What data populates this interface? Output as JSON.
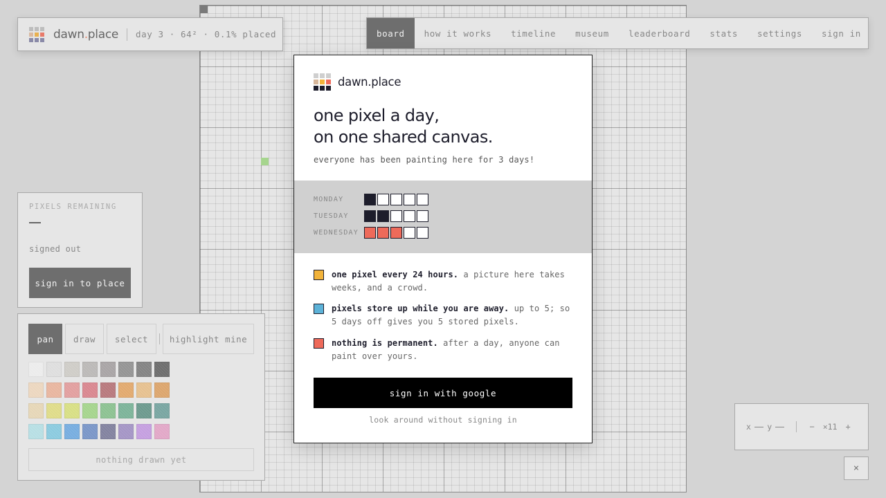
{
  "brand": {
    "name_main": "dawn",
    "name_dot": ".",
    "name_tld": "place",
    "stats": "day 3 · 64² · 0.1% placed",
    "logo_colors": [
      "#bdbdbd",
      "#bdbdbd",
      "#bdbdbd",
      "#d9b9a0",
      "#e8b050",
      "#e87a6a",
      "#8a8aa8",
      "#8a8aa8",
      "#8a8aa8"
    ]
  },
  "nav": {
    "items": [
      {
        "label": "board",
        "active": true
      },
      {
        "label": "how it works"
      },
      {
        "label": "timeline"
      },
      {
        "label": "museum"
      },
      {
        "label": "leaderboard"
      },
      {
        "label": "stats"
      },
      {
        "label": "settings"
      }
    ],
    "sign_in": "sign in"
  },
  "remaining": {
    "label": "PIXELS REMAINING",
    "status": "signed out",
    "signin_button": "sign in to place"
  },
  "tools": {
    "pan": "pan",
    "draw": "draw",
    "select": "select",
    "highlight": "highlight mine",
    "active": "pan",
    "palette": [
      [
        "#ececec",
        "#dedede",
        "#cfcdc8",
        "#bcbab8",
        "#a9a5a6",
        "#959595",
        "#848484",
        "#6e6e6e"
      ],
      [
        "#ecd7c0",
        "#e8b6a0",
        "#e2a0a0",
        "#d98890",
        "#b87a7e",
        "#e2aa70",
        "#e6c190",
        "#dca66e"
      ],
      [
        "#e6d7b8",
        "#dfdc8a",
        "#d8df86",
        "#a6d58e",
        "#8dc292",
        "#7db49a",
        "#6d9a8e",
        "#7aa6a2"
      ],
      [
        "#b8dfe4",
        "#8ccbdf",
        "#78aee0",
        "#7b97c8",
        "#8383a0",
        "#a596c6",
        "#c5a0e0",
        "#e2a8c8"
      ]
    ],
    "drawn_status": "nothing drawn yet"
  },
  "coords": {
    "x_label": "x",
    "y_label": "y",
    "zoom_out": "−",
    "zoom_level": "×11",
    "zoom_in": "+"
  },
  "close_label": "×",
  "canvas": {
    "placed_pixels": [
      {
        "col": 8,
        "row": 20,
        "color": "#a6d58e"
      }
    ]
  },
  "modal": {
    "brand": "dawn.place",
    "logo_colors": [
      "#cfcfcf",
      "#cfcfcf",
      "#cfcfcf",
      "#d6b69a",
      "#f2b33a",
      "#ee6a5a",
      "#1d1d2b",
      "#1d1d2b",
      "#1d1d2b"
    ],
    "headline_1": "one pixel a day,",
    "headline_2": "on one shared canvas.",
    "subline": "everyone has been painting here for 3 days!",
    "days": [
      {
        "label": "MONDAY",
        "cells": [
          "#1d1d2b",
          "#ffffff",
          "#ffffff",
          "#ffffff",
          "#ffffff"
        ]
      },
      {
        "label": "TUESDAY",
        "cells": [
          "#1d1d2b",
          "#1d1d2b",
          "#ffffff",
          "#ffffff",
          "#ffffff"
        ]
      },
      {
        "label": "WEDNESDAY",
        "cells": [
          "#ee6a5a",
          "#ee6a5a",
          "#ee6a5a",
          "#ffffff",
          "#ffffff"
        ]
      }
    ],
    "rules": [
      {
        "color": "#f2b33a",
        "bold": "one pixel every 24 hours.",
        "rest": " a picture here takes weeks, and a crowd."
      },
      {
        "color": "#5cb2d8",
        "bold": "pixels store up while you are away.",
        "rest": " up to 5; so 5 days off gives you 5 stored pixels."
      },
      {
        "color": "#ee6a5a",
        "bold": "nothing is permanent.",
        "rest": " after a day, anyone can paint over yours."
      }
    ],
    "google_button": "sign in with google",
    "look_link": "look around without signing in"
  }
}
